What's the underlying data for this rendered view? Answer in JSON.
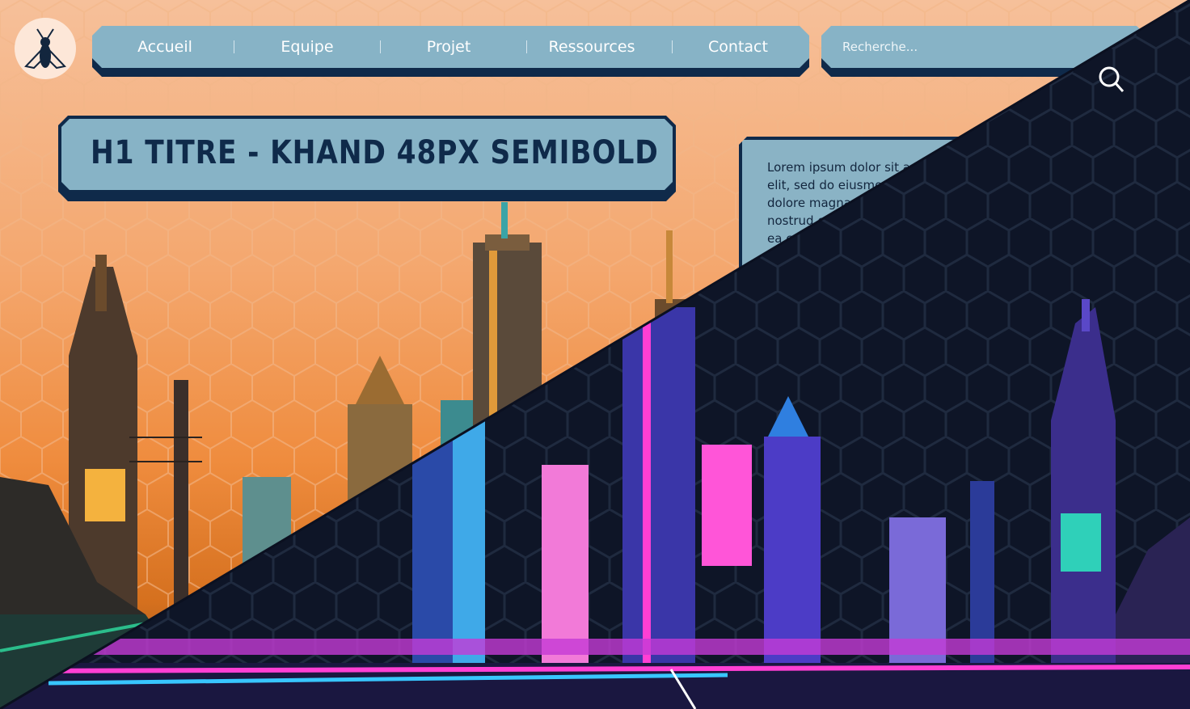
{
  "nav": {
    "logo_icon": "wasp-icon",
    "items": [
      {
        "label": "Accueil"
      },
      {
        "label": "Equipe"
      },
      {
        "label": "Projet"
      },
      {
        "label": "Ressources"
      },
      {
        "label": "Contact"
      }
    ]
  },
  "search": {
    "placeholder": "Recherche...",
    "icon": "search-icon"
  },
  "header": {
    "title": "H1 TITRE - KHAND 48PX SEMIBOLD"
  },
  "card": {
    "text": "Lorem ipsum dolor sit amet, consectetur adipiscing elit, sed do eiusmod tempor incididunt ut labore et dolore magna aliqua. Ut enim ad minim veniam, quis nostrud exercitation ullamco laboris nisi ut aliquip ex ea commodo consequat."
  },
  "theme": {
    "light_bg": "#f4a76e",
    "dark_bg": "#0e1527",
    "panel": "#87b3c6",
    "panel_shadow": "#0f2a4a",
    "neon_pink": "#ff3fd4",
    "neon_cyan": "#38c6ff",
    "neon_purple": "#6b2fd0"
  }
}
